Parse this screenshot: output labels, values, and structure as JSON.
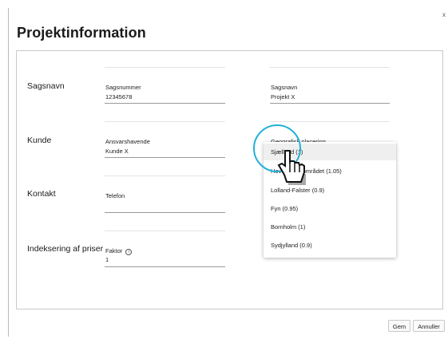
{
  "window": {
    "close_glyph": "x"
  },
  "page": {
    "title": "Projektinformation"
  },
  "sections": {
    "sagsnavn": "Sagsnavn",
    "kunde": "Kunde",
    "kontakt": "Kontakt",
    "indeksering": "Indeksering af priser"
  },
  "fields": {
    "sagsnummer": {
      "label": "Sagsnummer",
      "value": "12345678"
    },
    "sagsnavn": {
      "label": "Sagsnavn",
      "value": "Projekt X"
    },
    "ansvarshavende": {
      "label": "Ansvarshavende",
      "value": "Kunde X"
    },
    "geografisk": {
      "label": "Geografisk placering"
    },
    "telefon": {
      "label": "Telefon",
      "value": ""
    },
    "faktor": {
      "label": "Faktor",
      "info_icon": "ⓘ",
      "value": "1"
    }
  },
  "dropdown": {
    "options": [
      {
        "label": "Sjælland (1)",
        "selected": true
      },
      {
        "label": "Hovedstadsområdet (1.05)",
        "selected": false
      },
      {
        "label": "Lolland-Falster (0.9)",
        "selected": false
      },
      {
        "label": "Fyn (0.95)",
        "selected": false
      },
      {
        "label": "Bornholm (1)",
        "selected": false
      },
      {
        "label": "Sydjylland (0.9)",
        "selected": false
      }
    ]
  },
  "buttons": {
    "save": "Gem",
    "cancel": "Annuller"
  },
  "overlay": {
    "cursor_icon": "hand-pointer-icon",
    "highlight_color": "#22b1d8"
  }
}
